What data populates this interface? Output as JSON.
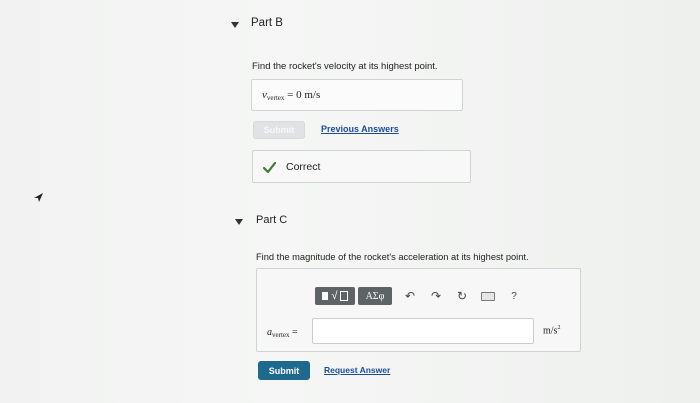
{
  "partB": {
    "title": "Part B",
    "prompt": "Find the rocket's velocity at its highest point.",
    "answer_var": "v",
    "answer_sub": "vertex",
    "answer_eq": " = ",
    "answer_value": "0 m/s",
    "submit_label": "Submit",
    "previous_answers_label": "Previous Answers",
    "feedback": "Correct"
  },
  "partC": {
    "title": "Part C",
    "prompt": "Find the magnitude of the rocket's acceleration at its highest point.",
    "toolbar": {
      "template_label": "√",
      "greek_label": "AΣφ",
      "help_label": "?",
      "icons": [
        "matrix-template-icon",
        "undo-icon",
        "redo-icon",
        "reset-icon",
        "keyboard-icon",
        "help-icon"
      ]
    },
    "answer_var": "a",
    "answer_sub": "vertex",
    "answer_eq": " =",
    "input_value": "",
    "unit": "m/s",
    "unit_exp": "2",
    "submit_label": "Submit",
    "request_answer_label": "Request Answer"
  },
  "colors": {
    "submit_active": "#1d6a8e",
    "submit_disabled": "#c5cbcc",
    "link": "#1b4d9c",
    "check": "#3f7d2e"
  }
}
